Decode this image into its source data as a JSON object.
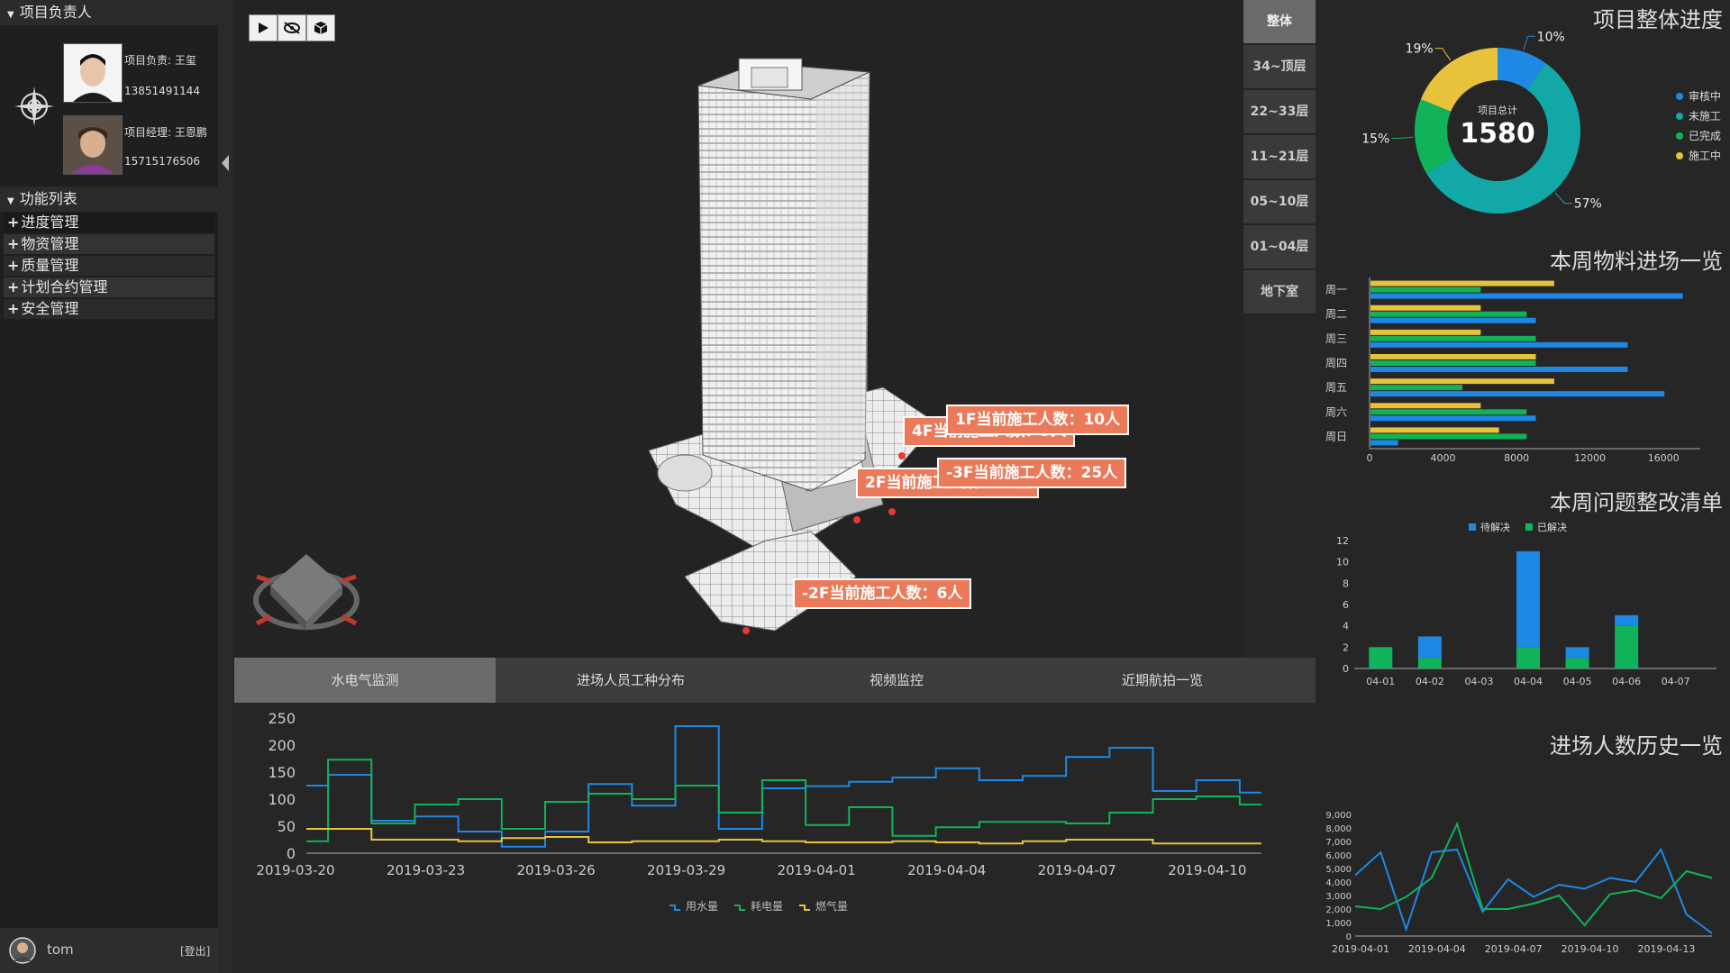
{
  "sidebar": {
    "project_head_title": "项目负责人",
    "people": [
      {
        "role": "项目负责: 王玺",
        "phone": "13851491144"
      },
      {
        "role": "项目经理: 王恩鹏",
        "phone": "15715176506"
      }
    ],
    "function_list_title": "功能列表",
    "menu": [
      "进度管理",
      "物资管理",
      "质量管理",
      "计划合约管理",
      "安全管理"
    ]
  },
  "user": {
    "name": "tom",
    "logout": "[登出]"
  },
  "floors": [
    "整体",
    "34~顶层",
    "22~33层",
    "11~21层",
    "05~10层",
    "01~04层",
    "地下室"
  ],
  "callouts": [
    {
      "text": "4F当前施工人数：9人"
    },
    {
      "text": "1F当前施工人数：10人"
    },
    {
      "text": "2F当前施工人数：20人"
    },
    {
      "text": "-3F当前施工人数：25人"
    },
    {
      "text": "-2F当前施工人数：6人"
    }
  ],
  "tabs": [
    "水电气监测",
    "进场人员工种分布",
    "视频监控",
    "近期航拍一览"
  ],
  "colors": {
    "blue": "#1e88e5",
    "cyan": "#12a8a8",
    "green": "#11b35a",
    "yellow": "#e8c23a",
    "callout": "#ea7a5a"
  },
  "donut": {
    "title": "项目整体进度",
    "center_label": "项目总计",
    "center_value": "1580",
    "slices": [
      {
        "name": "审核中",
        "value": 10,
        "label": "10%"
      },
      {
        "name": "未施工",
        "value": 57,
        "label": "57%"
      },
      {
        "name": "已完成",
        "value": 15,
        "label": "15%"
      },
      {
        "name": "施工中",
        "value": 19,
        "label": "19%"
      }
    ]
  },
  "material": {
    "title": "本周物料进场一览",
    "categories": [
      "周一",
      "周二",
      "周三",
      "周四",
      "周五",
      "周六",
      "周日"
    ],
    "xticks": [
      "0",
      "4000",
      "8000",
      "12000",
      "16000"
    ],
    "xmax": 18000,
    "series": [
      {
        "color": "#e8c23a",
        "values": [
          10000,
          6000,
          6000,
          9000,
          10000,
          6000,
          7000
        ]
      },
      {
        "color": "#11b35a",
        "values": [
          6000,
          8500,
          9000,
          9000,
          5000,
          8500,
          8500
        ]
      },
      {
        "color": "#1e88e5",
        "values": [
          17000,
          9000,
          14000,
          14000,
          16000,
          9000,
          1500
        ]
      }
    ]
  },
  "issues": {
    "title": "本周问题整改清单",
    "legend": [
      "待解决",
      "已解决"
    ],
    "categories": [
      "04-01",
      "04-02",
      "04-03",
      "04-04",
      "04-05",
      "04-06",
      "04-07"
    ],
    "pending": [
      0,
      2,
      0,
      9,
      1,
      1,
      0
    ],
    "resolved": [
      2,
      1,
      0,
      2,
      1,
      4,
      0
    ],
    "yticks": [
      "0",
      "2",
      "4",
      "6",
      "8",
      "10",
      "12"
    ],
    "ymax": 12
  },
  "entry": {
    "title": "进场人数历史一览",
    "yticks": [
      "0",
      "1,000",
      "2,000",
      "3,000",
      "4,000",
      "5,000",
      "6,000",
      "7,000",
      "8,000",
      "9,000"
    ],
    "xticks": [
      "2019-04-01",
      "2019-04-04",
      "2019-04-07",
      "2019-04-10",
      "2019-04-13"
    ],
    "blue": [
      4500,
      6200,
      500,
      6200,
      6400,
      1800,
      4200,
      2900,
      3800,
      3500,
      4300,
      4000,
      6400,
      1600,
      200
    ],
    "green": [
      2200,
      2000,
      2900,
      4300,
      8300,
      2000,
      2000,
      2400,
      3000,
      800,
      3100,
      3400,
      2800,
      4800,
      4300
    ]
  },
  "chart_data": {
    "type": "line",
    "x": [
      "2019-03-20",
      "2019-03-21",
      "2019-03-22",
      "2019-03-23",
      "2019-03-24",
      "2019-03-25",
      "2019-03-26",
      "2019-03-27",
      "2019-03-28",
      "2019-03-29",
      "2019-03-30",
      "2019-03-31",
      "2019-04-01",
      "2019-04-02",
      "2019-04-03",
      "2019-04-04",
      "2019-04-05",
      "2019-04-06",
      "2019-04-07",
      "2019-04-08",
      "2019-04-09",
      "2019-04-10",
      "2019-04-11"
    ],
    "xticks": [
      "2019-03-20",
      "2019-03-23",
      "2019-03-26",
      "2019-03-29",
      "2019-04-01",
      "2019-04-04",
      "2019-04-07",
      "2019-04-10"
    ],
    "yticks": [
      "0",
      "50",
      "100",
      "150",
      "200",
      "250"
    ],
    "ylim": [
      0,
      250
    ],
    "series": [
      {
        "name": "用水量",
        "color": "#1e88e5",
        "values": [
          125,
          145,
          60,
          68,
          40,
          12,
          40,
          128,
          88,
          235,
          45,
          120,
          124,
          132,
          140,
          157,
          135,
          143,
          178,
          195,
          115,
          135,
          112
        ]
      },
      {
        "name": "耗电量",
        "color": "#11b35a",
        "values": [
          22,
          173,
          55,
          90,
          100,
          45,
          95,
          110,
          100,
          125,
          75,
          135,
          52,
          85,
          32,
          48,
          58,
          58,
          55,
          75,
          100,
          105,
          90
        ]
      },
      {
        "name": "燃气量",
        "color": "#e8c23a",
        "values": [
          45,
          45,
          25,
          25,
          22,
          28,
          30,
          20,
          22,
          22,
          25,
          22,
          20,
          20,
          22,
          20,
          18,
          22,
          25,
          25,
          18,
          18,
          18
        ]
      }
    ]
  }
}
